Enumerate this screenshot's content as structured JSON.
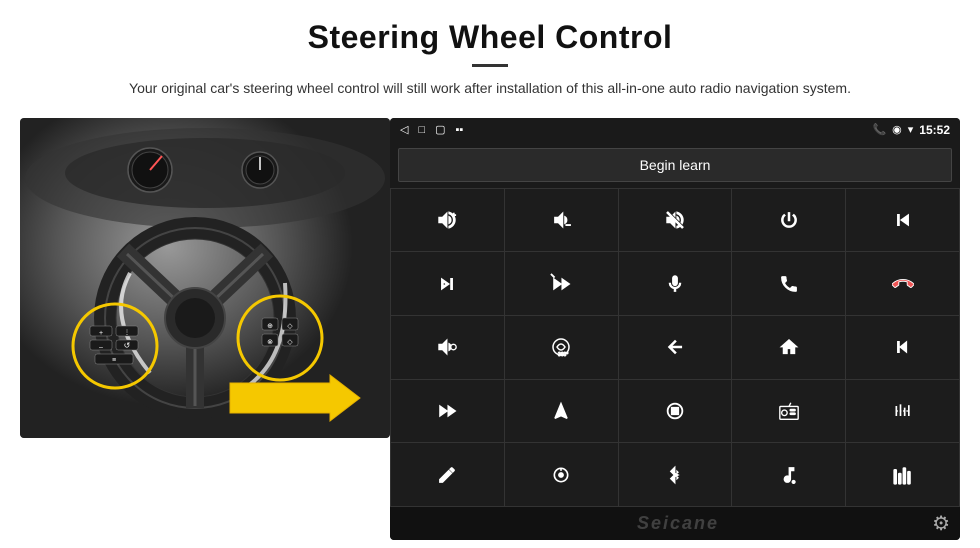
{
  "header": {
    "title": "Steering Wheel Control",
    "subtitle": "Your original car's steering wheel control will still work after installation of this all-in-one auto radio navigation system."
  },
  "status_bar": {
    "time": "15:52",
    "icons": [
      "◁",
      "□",
      "▢",
      "▪▪"
    ]
  },
  "begin_learn": {
    "label": "Begin learn"
  },
  "watermark": {
    "text": "Seicane"
  },
  "controls": [
    {
      "icon": "vol_up",
      "unicode": "🔊+"
    },
    {
      "icon": "vol_down",
      "unicode": "🔉–"
    },
    {
      "icon": "mute",
      "unicode": "🔇×"
    },
    {
      "icon": "power",
      "unicode": "⏻"
    },
    {
      "icon": "prev_track",
      "unicode": "⏮"
    },
    {
      "icon": "next_track",
      "unicode": "⏭"
    },
    {
      "icon": "ff_prev",
      "unicode": "⏪×"
    },
    {
      "icon": "mic",
      "unicode": "🎤"
    },
    {
      "icon": "phone",
      "unicode": "📞"
    },
    {
      "icon": "hang_up",
      "unicode": "📵"
    },
    {
      "icon": "horn",
      "unicode": "📢"
    },
    {
      "icon": "360_cam",
      "unicode": "🔄"
    },
    {
      "icon": "back",
      "unicode": "↩"
    },
    {
      "icon": "home",
      "unicode": "⌂"
    },
    {
      "icon": "rewind",
      "unicode": "⏮⏮"
    },
    {
      "icon": "ff",
      "unicode": "⏭"
    },
    {
      "icon": "nav",
      "unicode": "▶"
    },
    {
      "icon": "eject",
      "unicode": "⏏"
    },
    {
      "icon": "radio",
      "unicode": "📻"
    },
    {
      "icon": "eq",
      "unicode": "🎚"
    },
    {
      "icon": "pen",
      "unicode": "🖊"
    },
    {
      "icon": "settings2",
      "unicode": "⚙"
    },
    {
      "icon": "bluetooth",
      "unicode": "⚡"
    },
    {
      "icon": "music",
      "unicode": "🎵"
    },
    {
      "icon": "bars",
      "unicode": "|||"
    }
  ]
}
